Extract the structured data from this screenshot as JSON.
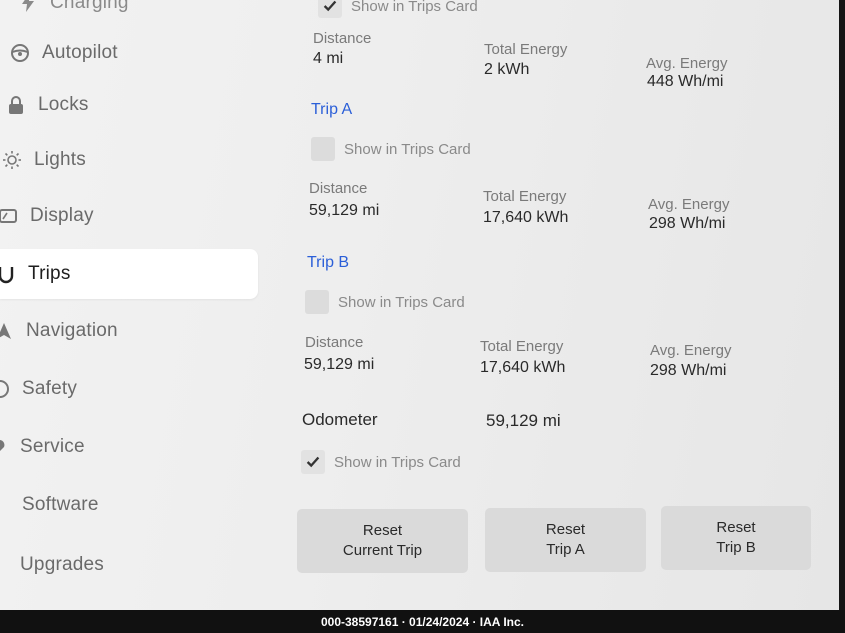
{
  "sidebar": {
    "items": [
      {
        "label": "Charging",
        "icon": "charging-icon"
      },
      {
        "label": "Autopilot",
        "icon": "steering-wheel-icon"
      },
      {
        "label": "Locks",
        "icon": "lock-icon"
      },
      {
        "label": "Lights",
        "icon": "light-bulb-icon"
      },
      {
        "label": "Display",
        "icon": "display-icon"
      },
      {
        "label": "Trips",
        "icon": "trips-icon",
        "active": true
      },
      {
        "label": "Navigation",
        "icon": "navigation-icon"
      },
      {
        "label": "Safety",
        "icon": "safety-icon"
      },
      {
        "label": "Service",
        "icon": "service-icon"
      },
      {
        "label": "Software",
        "icon": ""
      },
      {
        "label": "Upgrades",
        "icon": ""
      }
    ]
  },
  "current_trip": {
    "show_in_trips_card": "Show in Trips Card",
    "checked": true,
    "distance_label": "Distance",
    "distance": "4 mi",
    "energy_label": "Total Energy",
    "energy": "2 kWh",
    "avg_label": "Avg. Energy",
    "avg": "448 Wh/mi"
  },
  "trip_a": {
    "title": "Trip A",
    "show_in_trips_card": "Show in Trips Card",
    "checked": false,
    "distance_label": "Distance",
    "distance": "59,129 mi",
    "energy_label": "Total Energy",
    "energy": "17,640 kWh",
    "avg_label": "Avg. Energy",
    "avg": "298 Wh/mi"
  },
  "trip_b": {
    "title": "Trip B",
    "show_in_trips_card": "Show in Trips Card",
    "checked": false,
    "distance_label": "Distance",
    "distance": "59,129 mi",
    "energy_label": "Total Energy",
    "energy": "17,640 kWh",
    "avg_label": "Avg. Energy",
    "avg": "298 Wh/mi"
  },
  "odometer": {
    "label": "Odometer",
    "value": "59,129 mi",
    "show_in_trips_card": "Show in Trips Card",
    "checked": true
  },
  "buttons": {
    "reset_current_line1": "Reset",
    "reset_current_line2": "Current Trip",
    "reset_a_line1": "Reset",
    "reset_a_line2": "Trip A",
    "reset_b_line1": "Reset",
    "reset_b_line2": "Trip B"
  },
  "footer": {
    "watermark": "000-38597161 · 01/24/2024 · IAA Inc."
  },
  "colors": {
    "accent": "#2b5fd8",
    "background": "#eeeeee",
    "button": "#dadada"
  }
}
